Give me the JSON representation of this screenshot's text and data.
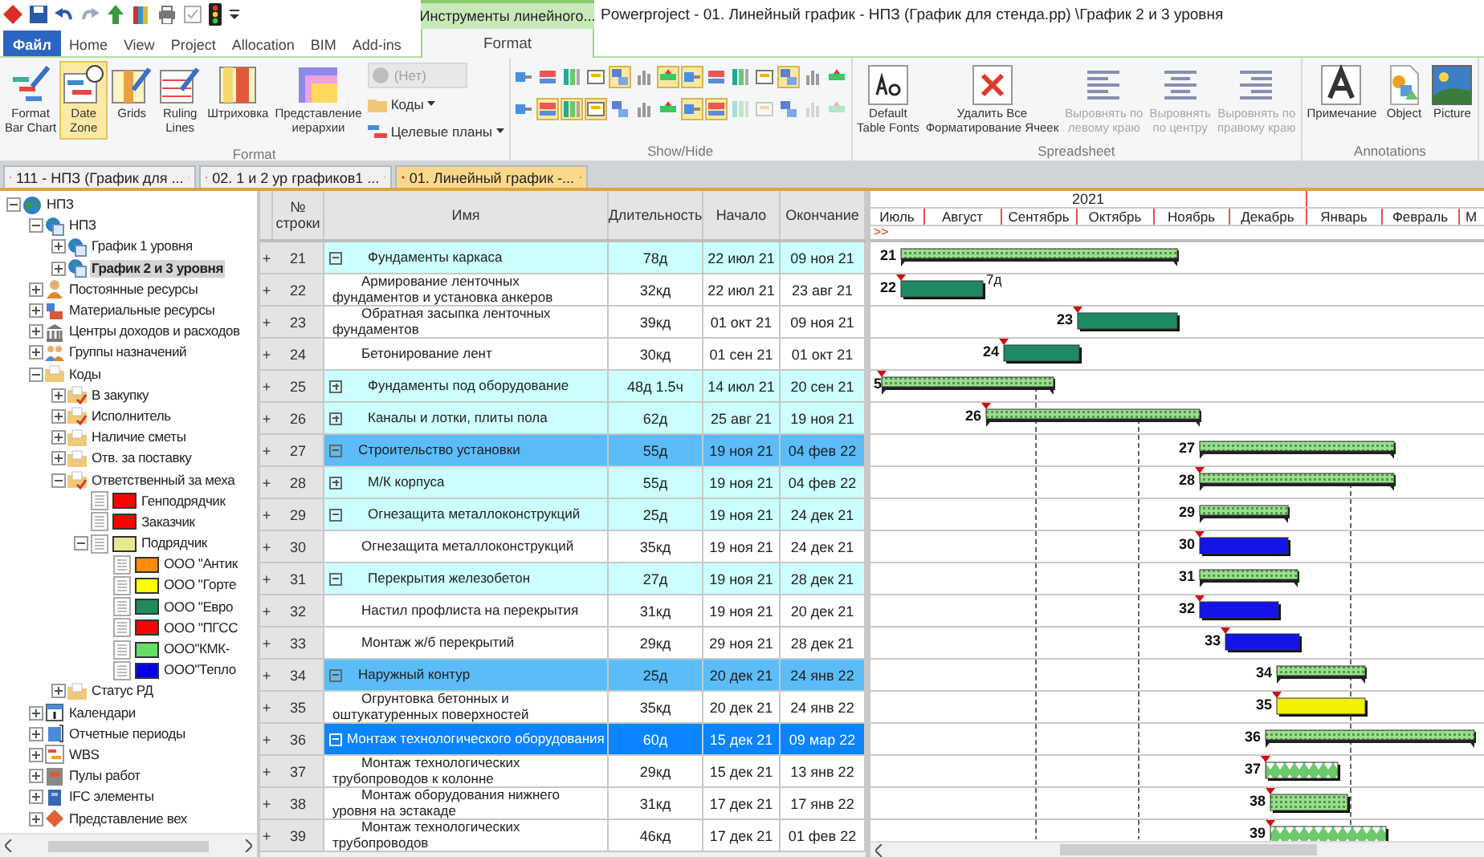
{
  "title": "Powerproject - 01. Линейный график - НПЗ (График для стенда.pp) \\График 2 и 3 уровня",
  "ribbon_tabs": [
    {
      "label": "Файл",
      "kind": "file",
      "selected": false
    },
    {
      "label": "Home",
      "kind": "tab",
      "selected": false
    },
    {
      "label": "View",
      "kind": "tab",
      "selected": false
    },
    {
      "label": "Project",
      "kind": "tab",
      "selected": false
    },
    {
      "label": "Allocation",
      "kind": "tab",
      "selected": false
    },
    {
      "label": "BIM",
      "kind": "tab",
      "selected": false
    },
    {
      "label": "Add-ins",
      "kind": "tab",
      "selected": false
    }
  ],
  "context": {
    "title": "Инструменты линейного...",
    "tab": "Format",
    "selected": true
  },
  "ribbon": {
    "format": {
      "label": "Format",
      "buttons": [
        {
          "label": "Format\nBar Chart",
          "on": false
        },
        {
          "label": "Date\nZone",
          "on": true
        },
        {
          "label": "Grids",
          "on": false
        },
        {
          "label": "Ruling\nLines",
          "on": false
        },
        {
          "label": "Штриховка",
          "on": false
        },
        {
          "label": "Представление\nиерархии",
          "on": false
        }
      ],
      "dropdown": {
        "value": "(Нет)",
        "disabled": true
      },
      "menus": [
        {
          "label": "Коды"
        },
        {
          "label": "Целевые планы"
        }
      ]
    },
    "show_hide": {
      "label": "Show/Hide",
      "toggles": [
        {
          "on": false,
          "disabled": false
        },
        {
          "on": false,
          "disabled": false
        },
        {
          "on": false,
          "disabled": false
        },
        {
          "on": false,
          "disabled": false
        },
        {
          "on": true,
          "disabled": false
        },
        {
          "on": false,
          "disabled": false
        },
        {
          "on": true,
          "disabled": false
        },
        {
          "on": true,
          "disabled": false
        },
        {
          "on": false,
          "disabled": false
        },
        {
          "on": false,
          "disabled": false
        },
        {
          "on": false,
          "disabled": false
        },
        {
          "on": true,
          "disabled": false
        },
        {
          "on": false,
          "disabled": false
        },
        {
          "on": false,
          "disabled": false
        },
        {
          "on": false,
          "disabled": false
        },
        {
          "on": true,
          "disabled": false
        },
        {
          "on": true,
          "disabled": false
        },
        {
          "on": true,
          "disabled": false
        },
        {
          "on": false,
          "disabled": false
        },
        {
          "on": false,
          "disabled": false
        },
        {
          "on": false,
          "disabled": false
        },
        {
          "on": true,
          "disabled": false
        },
        {
          "on": true,
          "disabled": false
        },
        {
          "on": false,
          "disabled": true
        },
        {
          "on": false,
          "disabled": true
        },
        {
          "on": false,
          "disabled": false
        },
        {
          "on": false,
          "disabled": true
        },
        {
          "on": false,
          "disabled": true
        }
      ]
    },
    "spreadsheet": {
      "label": "Spreadsheet",
      "buttons": [
        {
          "label": "Default\nTable Fonts",
          "disabled": false
        },
        {
          "label": "Удалить Все\nФорматирование Ячеек",
          "disabled": false
        },
        {
          "label": "Выровнять по\nлевому краю",
          "disabled": true
        },
        {
          "label": "Выровнять\nпо центру",
          "disabled": true
        },
        {
          "label": "Выровнять по\nправому краю",
          "disabled": true
        }
      ]
    },
    "annotations": {
      "label": "Annotations",
      "buttons": [
        {
          "label": "Примечание"
        },
        {
          "label": "Object"
        },
        {
          "label": "Picture"
        }
      ]
    }
  },
  "doc_tabs": [
    {
      "label": "111 - НПЗ (График для ...",
      "selected": false
    },
    {
      "label": "02. 1 и 2 ур графиков1 ...",
      "selected": false
    },
    {
      "label": "01. Линейный график -...",
      "selected": true
    }
  ],
  "tree": [
    {
      "label": "НПЗ",
      "kind": "globe",
      "expanded": true,
      "selected": false,
      "children": [
        {
          "label": "НПЗ",
          "kind": "project",
          "expanded": true,
          "selected": false,
          "children": [
            {
              "label": "График 1 уровня",
              "kind": "project",
              "expanded": false,
              "selected": false
            },
            {
              "label": "График 2 и 3 уровня",
              "kind": "project",
              "expanded": false,
              "selected": true
            }
          ]
        },
        {
          "label": "Постоянные ресурсы",
          "kind": "person",
          "expanded": false,
          "selected": false
        },
        {
          "label": "Материальные ресурсы",
          "kind": "material",
          "expanded": false,
          "selected": false
        },
        {
          "label": "Центры доходов и расходов",
          "kind": "bank",
          "expanded": false,
          "selected": false
        },
        {
          "label": "Группы назначений",
          "kind": "group",
          "expanded": false,
          "selected": false
        },
        {
          "label": "Коды",
          "kind": "folder",
          "expanded": true,
          "selected": false,
          "children": [
            {
              "label": "В закупку",
              "kind": "folder-check",
              "expanded": false,
              "selected": false
            },
            {
              "label": "Исполнитель",
              "kind": "folder-check",
              "expanded": false,
              "selected": false
            },
            {
              "label": "Наличие сметы",
              "kind": "folder",
              "expanded": false,
              "selected": false
            },
            {
              "label": "Отв. за поставку",
              "kind": "folder",
              "expanded": false,
              "selected": false
            },
            {
              "label": "Ответственный за меха",
              "kind": "folder-check",
              "expanded": true,
              "selected": false,
              "children": [
                {
                  "label": "Генподрядчик",
                  "kind": "code",
                  "color": "#ff0000",
                  "selected": false
                },
                {
                  "label": "Заказчик",
                  "kind": "code",
                  "color": "#ff0000",
                  "selected": false
                },
                {
                  "label": "Подрядчик",
                  "kind": "code",
                  "color": "#e8e890",
                  "expanded": true,
                  "selected": false,
                  "children": [
                    {
                      "label": "ООО \"Антик",
                      "kind": "code",
                      "color": "#ff8c00",
                      "selected": false
                    },
                    {
                      "label": "ООО \"Горте",
                      "kind": "code",
                      "color": "#ffff00",
                      "selected": false
                    },
                    {
                      "label": "ООО \"Евро",
                      "kind": "code",
                      "color": "#1e8a5e",
                      "selected": false
                    },
                    {
                      "label": "ООО \"ПГСС",
                      "kind": "code",
                      "color": "#ff0000",
                      "selected": false
                    },
                    {
                      "label": "ООО\"КМК-",
                      "kind": "code",
                      "color": "#66dd66",
                      "selected": false
                    },
                    {
                      "label": "ООО\"Тепло",
                      "kind": "code",
                      "color": "#0000ee",
                      "selected": false
                    }
                  ]
                }
              ]
            },
            {
              "label": "Статус РД",
              "kind": "folder",
              "expanded": false,
              "selected": false
            }
          ]
        },
        {
          "label": "Календари",
          "kind": "calendar",
          "expanded": false,
          "selected": false
        },
        {
          "label": "Отчетные периоды",
          "kind": "period",
          "expanded": false,
          "selected": false
        },
        {
          "label": "WBS",
          "kind": "wbs",
          "expanded": false,
          "selected": false
        },
        {
          "label": "Пулы работ",
          "kind": "pool",
          "expanded": false,
          "selected": false
        },
        {
          "label": "IFC элементы",
          "kind": "ifc",
          "expanded": false,
          "selected": false
        },
        {
          "label": "Представление вех",
          "kind": "milestone",
          "expanded": false,
          "selected": false
        }
      ]
    }
  ],
  "table": {
    "columns": [
      "№\nстроки",
      "Имя",
      "Длительность",
      "Начало",
      "Окончание"
    ],
    "rows": [
      {
        "mark": "+",
        "num": "21",
        "name": "Фундаменты каркаса",
        "duration": "78д",
        "start": "22 июл 21",
        "end": "09 ноя 21",
        "kind": "summary2",
        "expanded": true,
        "selected": false
      },
      {
        "mark": "+",
        "num": "22",
        "name": "Армирование ленточных фундаментов и установка анкеров",
        "duration": "32кд",
        "start": "22 июл 21",
        "end": "23 авг 21",
        "kind": "task",
        "selected": false
      },
      {
        "mark": "+",
        "num": "23",
        "name": "Обратная засыпка ленточных фундаментов",
        "duration": "39кд",
        "start": "01 окт 21",
        "end": "09 ноя 21",
        "kind": "task",
        "selected": false
      },
      {
        "mark": "+",
        "num": "24",
        "name": "Бетонирование лент",
        "duration": "30кд",
        "start": "01 сен 21",
        "end": "01 окт 21",
        "kind": "task",
        "selected": false
      },
      {
        "mark": "+",
        "num": "25",
        "name": "Фундаменты под оборудование",
        "duration": "48д 1.5ч",
        "start": "14 июл 21",
        "end": "20 сен 21",
        "kind": "summary2",
        "expanded": false,
        "selected": false
      },
      {
        "mark": "+",
        "num": "26",
        "name": "Каналы и лотки, плиты пола",
        "duration": "62д",
        "start": "25 авг 21",
        "end": "19 ноя 21",
        "kind": "summary2",
        "expanded": false,
        "selected": false
      },
      {
        "mark": "+",
        "num": "27",
        "name": "Строительство установки",
        "duration": "55д",
        "start": "19 ноя 21",
        "end": "04 фев 22",
        "kind": "summary1",
        "expanded": true,
        "selected": false
      },
      {
        "mark": "+",
        "num": "28",
        "name": "М/К корпуса",
        "duration": "55д",
        "start": "19 ноя 21",
        "end": "04 фев 22",
        "kind": "summary2",
        "expanded": false,
        "selected": false
      },
      {
        "mark": "+",
        "num": "29",
        "name": "Огнезащита металлоконструкций",
        "duration": "25д",
        "start": "19 ноя 21",
        "end": "24 дек 21",
        "kind": "summary2",
        "expanded": true,
        "selected": false
      },
      {
        "mark": "+",
        "num": "30",
        "name": "Огнезащита металлоконструкций",
        "duration": "35кд",
        "start": "19 ноя 21",
        "end": "24 дек 21",
        "kind": "task",
        "selected": false
      },
      {
        "mark": "+",
        "num": "31",
        "name": "Перекрытия железобетон",
        "duration": "27д",
        "start": "19 ноя 21",
        "end": "28 дек 21",
        "kind": "summary2",
        "expanded": true,
        "selected": false
      },
      {
        "mark": "+",
        "num": "32",
        "name": "Настил профлиста на перекрытия",
        "duration": "31кд",
        "start": "19 ноя 21",
        "end": "20 дек 21",
        "kind": "task",
        "selected": false
      },
      {
        "mark": "+",
        "num": "33",
        "name": "Монтаж ж/б перекрытий",
        "duration": "29кд",
        "start": "29 ноя 21",
        "end": "28 дек 21",
        "kind": "task",
        "selected": false
      },
      {
        "mark": "+",
        "num": "34",
        "name": "Наружный контур",
        "duration": "25д",
        "start": "20 дек 21",
        "end": "24 янв 22",
        "kind": "summary1",
        "expanded": true,
        "selected": false
      },
      {
        "mark": "+",
        "num": "35",
        "name": "Огрунтовка бетонных и оштукатуренных поверхностей",
        "duration": "35кд",
        "start": "20 дек 21",
        "end": "24 янв 22",
        "kind": "task",
        "selected": false
      },
      {
        "mark": "+",
        "num": "36",
        "name": "Монтаж технологического оборудования",
        "duration": "60д",
        "start": "15 дек 21",
        "end": "09 мар 22",
        "kind": "summary1",
        "expanded": true,
        "selected": true
      },
      {
        "mark": "+",
        "num": "37",
        "name": "Монтаж технологических трубопроводов к колонне",
        "duration": "29кд",
        "start": "15 дек 21",
        "end": "13 янв 22",
        "kind": "task",
        "selected": false
      },
      {
        "mark": "+",
        "num": "38",
        "name": "Монтаж оборудования нижнего уровня на эстакаде",
        "duration": "31кд",
        "start": "17 дек 21",
        "end": "17 янв 22",
        "kind": "task",
        "selected": false
      },
      {
        "mark": "+",
        "num": "39",
        "name": "Монтаж технологических трубопроводов",
        "duration": "46кд",
        "start": "17 дек 21",
        "end": "01 фев 22",
        "kind": "task",
        "selected": false
      }
    ]
  },
  "gantt": {
    "year": "2021",
    "months": [
      "Июль",
      "Август",
      "Сентябрь",
      "Октябрь",
      "Ноябрь",
      "Декабрь",
      "Январь",
      "Февраль",
      "М"
    ],
    "overflow_mark": ">>",
    "bars": [
      {
        "label": "21",
        "kind": "summary"
      },
      {
        "label": "22",
        "kind": "green",
        "note": "7д"
      },
      {
        "label": "23",
        "kind": "green"
      },
      {
        "label": "24",
        "kind": "green"
      },
      {
        "label": "5",
        "kind": "summary"
      },
      {
        "label": "26",
        "kind": "summary"
      },
      {
        "label": "27",
        "kind": "summary"
      },
      {
        "label": "28",
        "kind": "summary"
      },
      {
        "label": "29",
        "kind": "summary"
      },
      {
        "label": "30",
        "kind": "blue"
      },
      {
        "label": "31",
        "kind": "summary"
      },
      {
        "label": "32",
        "kind": "blue"
      },
      {
        "label": "33",
        "kind": "blue"
      },
      {
        "label": "34",
        "kind": "summary"
      },
      {
        "label": "35",
        "kind": "yellow"
      },
      {
        "label": "36",
        "kind": "summary"
      },
      {
        "label": "37",
        "kind": "dots"
      },
      {
        "label": "38",
        "kind": "hatch"
      },
      {
        "label": "39",
        "kind": "dots"
      }
    ]
  }
}
